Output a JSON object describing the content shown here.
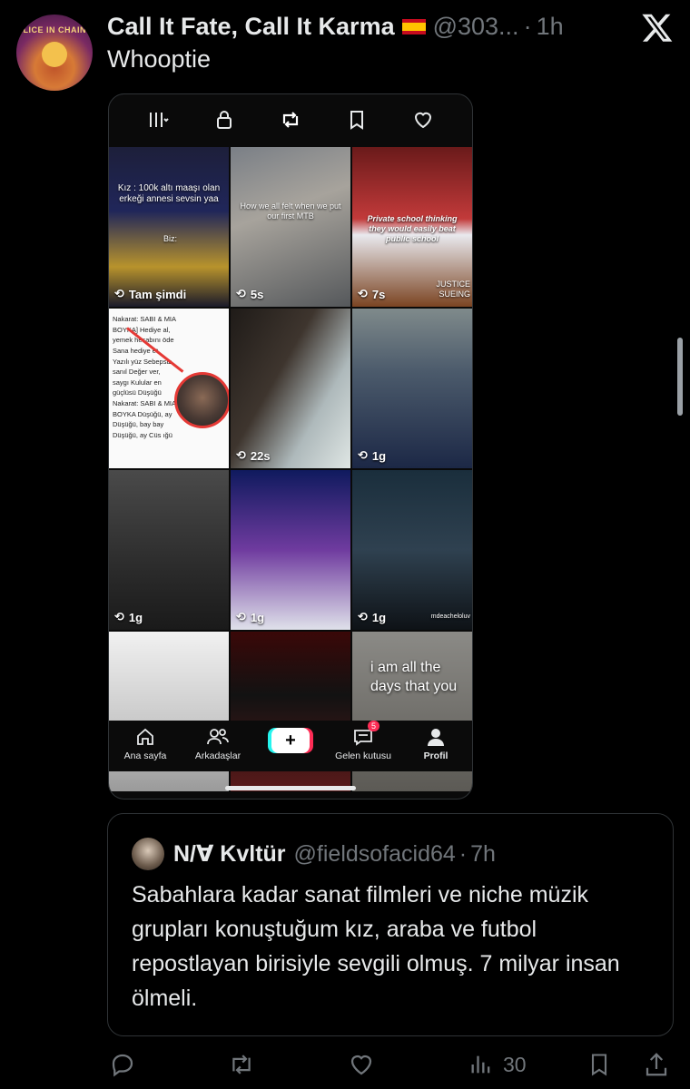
{
  "tweet": {
    "avatar_text": "ALICE IN CHAINS",
    "display_name": "Call It Fate, Call It Karma",
    "flag_icon": "spain-flag-emoji",
    "handle": "@303...",
    "separator": "·",
    "time": "1h",
    "text": "Whooptie"
  },
  "media": {
    "top_icons": [
      "grid-icon",
      "lock-icon",
      "repost-icon",
      "bookmark-icon",
      "heart-icon"
    ],
    "cells": [
      {
        "caption": "Tam şimdi",
        "overlay": "Kız : 100k altı maaşı olan erkeği annesi sevsin yaa",
        "sub": "Biz:"
      },
      {
        "caption": "5s",
        "overlay": "How we all felt when we put our first MTB"
      },
      {
        "caption": "7s",
        "overlay": "Private school thinking they would easily beat public school",
        "sub": "JUSTICE SUEING"
      },
      {
        "caption": "",
        "lyric": "Nakarat: SABI & MIA BOYKA] Hediye al, yemek hesabını öde Sana hediye et Yazılı yüz Sebepsiz sanıl Değer ver, saygı Kulular en güçlüsü Düşüğü Nakarat: SABI & MIA BOYKA Düşüğü, ay Düşüğü, bay bay Düşüğü, ay Cüs ığü"
      },
      {
        "caption": "22s"
      },
      {
        "caption": "1g"
      },
      {
        "caption": "1g"
      },
      {
        "caption": "1g"
      },
      {
        "caption": "1g",
        "sub": "mdeacheloluv"
      },
      {
        "caption": ""
      },
      {
        "caption": ""
      },
      {
        "caption": "",
        "overlay": "i am all the days that you"
      }
    ],
    "nav": {
      "home": "Ana sayfa",
      "friends": "Arkadaşlar",
      "create": "+",
      "inbox": "Gelen kutusu",
      "inbox_badge": "5",
      "profile": "Profil"
    }
  },
  "quote": {
    "display_name": "N/∀ Kvltür",
    "handle": "@fieldsofacid64",
    "separator": "·",
    "time": "7h",
    "text": "Sabahlara kadar sanat filmleri ve niche müzik grupları konuştuğum kız, araba ve futbol repostlayan birisiyle sevgili olmuş. 7 milyar insan ölmeli."
  },
  "actions": {
    "views": "30",
    "icons": [
      "reply-icon",
      "retweet-icon",
      "like-icon",
      "views-icon",
      "bookmark-icon",
      "share-icon"
    ]
  },
  "colors": {
    "background": "#000000",
    "text": "#e7e9ea",
    "muted": "#71767b",
    "border": "#2f3336",
    "tiktok_red": "#fe2c55"
  }
}
